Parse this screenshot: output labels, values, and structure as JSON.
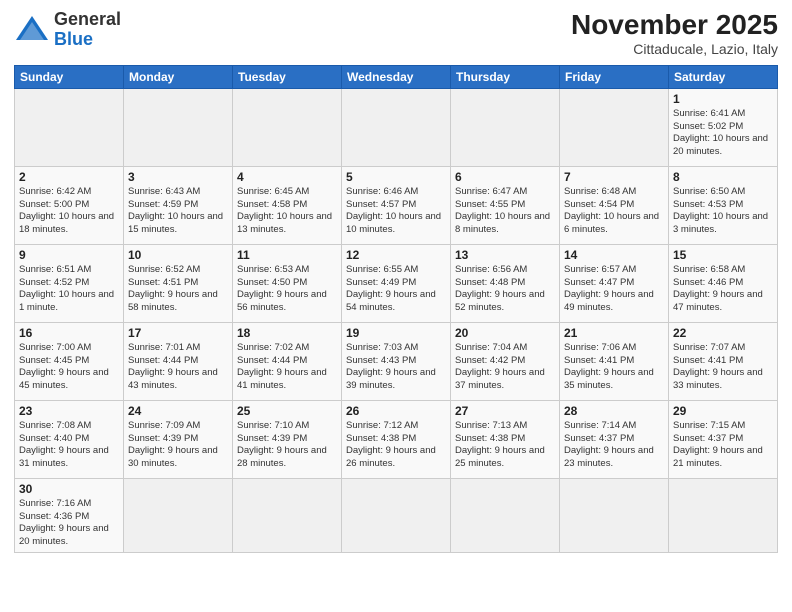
{
  "header": {
    "logo_general": "General",
    "logo_blue": "Blue",
    "month_title": "November 2025",
    "location": "Cittaducale, Lazio, Italy"
  },
  "weekdays": [
    "Sunday",
    "Monday",
    "Tuesday",
    "Wednesday",
    "Thursday",
    "Friday",
    "Saturday"
  ],
  "weeks": [
    [
      {
        "day": "",
        "info": ""
      },
      {
        "day": "",
        "info": ""
      },
      {
        "day": "",
        "info": ""
      },
      {
        "day": "",
        "info": ""
      },
      {
        "day": "",
        "info": ""
      },
      {
        "day": "",
        "info": ""
      },
      {
        "day": "1",
        "info": "Sunrise: 6:41 AM\nSunset: 5:02 PM\nDaylight: 10 hours\nand 20 minutes."
      }
    ],
    [
      {
        "day": "2",
        "info": "Sunrise: 6:42 AM\nSunset: 5:00 PM\nDaylight: 10 hours\nand 18 minutes."
      },
      {
        "day": "3",
        "info": "Sunrise: 6:43 AM\nSunset: 4:59 PM\nDaylight: 10 hours\nand 15 minutes."
      },
      {
        "day": "4",
        "info": "Sunrise: 6:45 AM\nSunset: 4:58 PM\nDaylight: 10 hours\nand 13 minutes."
      },
      {
        "day": "5",
        "info": "Sunrise: 6:46 AM\nSunset: 4:57 PM\nDaylight: 10 hours\nand 10 minutes."
      },
      {
        "day": "6",
        "info": "Sunrise: 6:47 AM\nSunset: 4:55 PM\nDaylight: 10 hours\nand 8 minutes."
      },
      {
        "day": "7",
        "info": "Sunrise: 6:48 AM\nSunset: 4:54 PM\nDaylight: 10 hours\nand 6 minutes."
      },
      {
        "day": "8",
        "info": "Sunrise: 6:50 AM\nSunset: 4:53 PM\nDaylight: 10 hours\nand 3 minutes."
      }
    ],
    [
      {
        "day": "9",
        "info": "Sunrise: 6:51 AM\nSunset: 4:52 PM\nDaylight: 10 hours\nand 1 minute."
      },
      {
        "day": "10",
        "info": "Sunrise: 6:52 AM\nSunset: 4:51 PM\nDaylight: 9 hours\nand 58 minutes."
      },
      {
        "day": "11",
        "info": "Sunrise: 6:53 AM\nSunset: 4:50 PM\nDaylight: 9 hours\nand 56 minutes."
      },
      {
        "day": "12",
        "info": "Sunrise: 6:55 AM\nSunset: 4:49 PM\nDaylight: 9 hours\nand 54 minutes."
      },
      {
        "day": "13",
        "info": "Sunrise: 6:56 AM\nSunset: 4:48 PM\nDaylight: 9 hours\nand 52 minutes."
      },
      {
        "day": "14",
        "info": "Sunrise: 6:57 AM\nSunset: 4:47 PM\nDaylight: 9 hours\nand 49 minutes."
      },
      {
        "day": "15",
        "info": "Sunrise: 6:58 AM\nSunset: 4:46 PM\nDaylight: 9 hours\nand 47 minutes."
      }
    ],
    [
      {
        "day": "16",
        "info": "Sunrise: 7:00 AM\nSunset: 4:45 PM\nDaylight: 9 hours\nand 45 minutes."
      },
      {
        "day": "17",
        "info": "Sunrise: 7:01 AM\nSunset: 4:44 PM\nDaylight: 9 hours\nand 43 minutes."
      },
      {
        "day": "18",
        "info": "Sunrise: 7:02 AM\nSunset: 4:44 PM\nDaylight: 9 hours\nand 41 minutes."
      },
      {
        "day": "19",
        "info": "Sunrise: 7:03 AM\nSunset: 4:43 PM\nDaylight: 9 hours\nand 39 minutes."
      },
      {
        "day": "20",
        "info": "Sunrise: 7:04 AM\nSunset: 4:42 PM\nDaylight: 9 hours\nand 37 minutes."
      },
      {
        "day": "21",
        "info": "Sunrise: 7:06 AM\nSunset: 4:41 PM\nDaylight: 9 hours\nand 35 minutes."
      },
      {
        "day": "22",
        "info": "Sunrise: 7:07 AM\nSunset: 4:41 PM\nDaylight: 9 hours\nand 33 minutes."
      }
    ],
    [
      {
        "day": "23",
        "info": "Sunrise: 7:08 AM\nSunset: 4:40 PM\nDaylight: 9 hours\nand 31 minutes."
      },
      {
        "day": "24",
        "info": "Sunrise: 7:09 AM\nSunset: 4:39 PM\nDaylight: 9 hours\nand 30 minutes."
      },
      {
        "day": "25",
        "info": "Sunrise: 7:10 AM\nSunset: 4:39 PM\nDaylight: 9 hours\nand 28 minutes."
      },
      {
        "day": "26",
        "info": "Sunrise: 7:12 AM\nSunset: 4:38 PM\nDaylight: 9 hours\nand 26 minutes."
      },
      {
        "day": "27",
        "info": "Sunrise: 7:13 AM\nSunset: 4:38 PM\nDaylight: 9 hours\nand 25 minutes."
      },
      {
        "day": "28",
        "info": "Sunrise: 7:14 AM\nSunset: 4:37 PM\nDaylight: 9 hours\nand 23 minutes."
      },
      {
        "day": "29",
        "info": "Sunrise: 7:15 AM\nSunset: 4:37 PM\nDaylight: 9 hours\nand 21 minutes."
      }
    ],
    [
      {
        "day": "30",
        "info": "Sunrise: 7:16 AM\nSunset: 4:36 PM\nDaylight: 9 hours\nand 20 minutes."
      },
      {
        "day": "",
        "info": ""
      },
      {
        "day": "",
        "info": ""
      },
      {
        "day": "",
        "info": ""
      },
      {
        "day": "",
        "info": ""
      },
      {
        "day": "",
        "info": ""
      },
      {
        "day": "",
        "info": ""
      }
    ]
  ]
}
